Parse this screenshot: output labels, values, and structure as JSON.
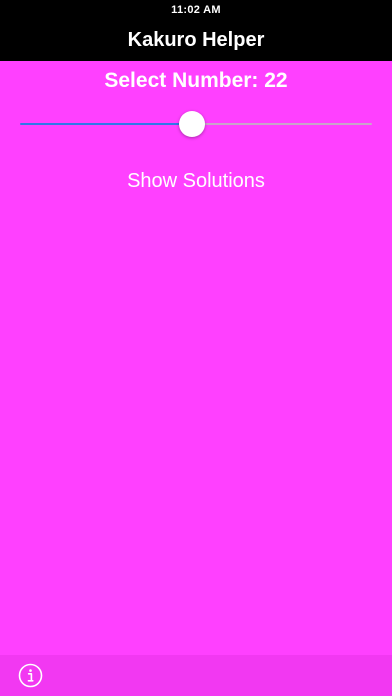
{
  "status_bar": {
    "time": "11:02 AM"
  },
  "nav": {
    "title": "Kakuro Helper"
  },
  "main": {
    "select_label": "Select Number: 22",
    "slider": {
      "min": 0,
      "max": 45,
      "value": 22
    },
    "show_solutions_label": "Show Solutions"
  },
  "toolbar": {
    "info_icon": "info-circle-icon"
  },
  "colors": {
    "background": "#ff40ff",
    "bar": "#000000",
    "bottom_bar": "#f238f2",
    "slider_active": "#2f78e8",
    "text": "#ffffff"
  }
}
